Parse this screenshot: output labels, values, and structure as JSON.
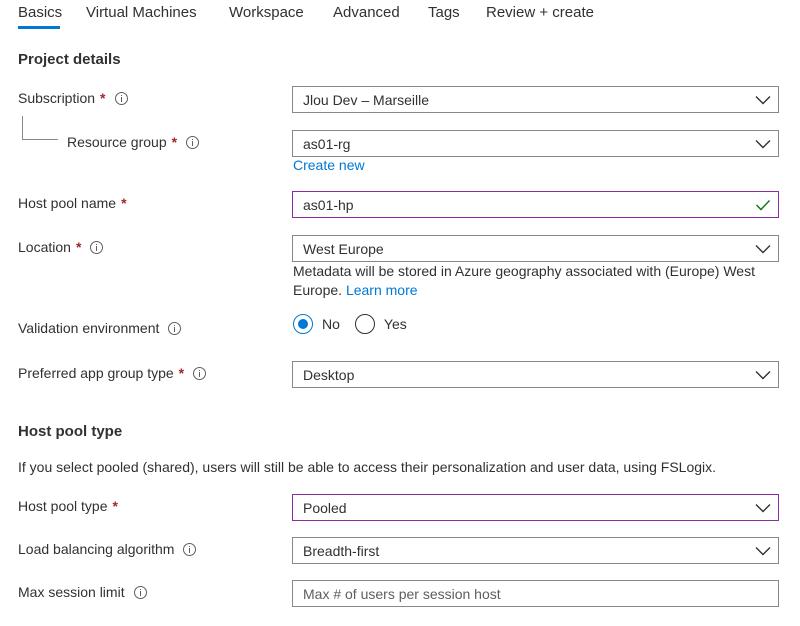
{
  "tabs": [
    {
      "label": "Basics",
      "active": true
    },
    {
      "label": "Virtual Machines"
    },
    {
      "label": "Workspace"
    },
    {
      "label": "Advanced"
    },
    {
      "label": "Tags"
    },
    {
      "label": "Review + create"
    }
  ],
  "accent_color": "#0078d4",
  "required_color": "#a4262c",
  "project": {
    "title": "Project details",
    "subscription": {
      "label": "Subscription",
      "value": "Jlou Dev – Marseille"
    },
    "resource_group": {
      "label": "Resource group",
      "value": "as01-rg",
      "create_new": "Create new"
    },
    "host_pool_name": {
      "label": "Host pool name",
      "value": "as01-hp"
    },
    "location": {
      "label": "Location",
      "value": "West Europe",
      "help": "Metadata will be stored in Azure geography associated with (Europe) West Europe.",
      "learn_more": "Learn more"
    },
    "validation": {
      "label": "Validation environment",
      "options": [
        "No",
        "Yes"
      ],
      "selected": "No"
    },
    "app_group_type": {
      "label": "Preferred app group type",
      "value": "Desktop"
    },
    "required_mark": "*"
  },
  "host_pool_type_section": {
    "title": "Host pool type",
    "description": "If you select pooled (shared), users will still be able to access their personalization and user data, using FSLogix.",
    "host_pool_type": {
      "label": "Host pool type",
      "value": "Pooled"
    },
    "load_balancing": {
      "label": "Load balancing algorithm",
      "value": "Breadth-first"
    },
    "max_session": {
      "label": "Max session limit",
      "placeholder": "Max # of users per session host"
    }
  }
}
